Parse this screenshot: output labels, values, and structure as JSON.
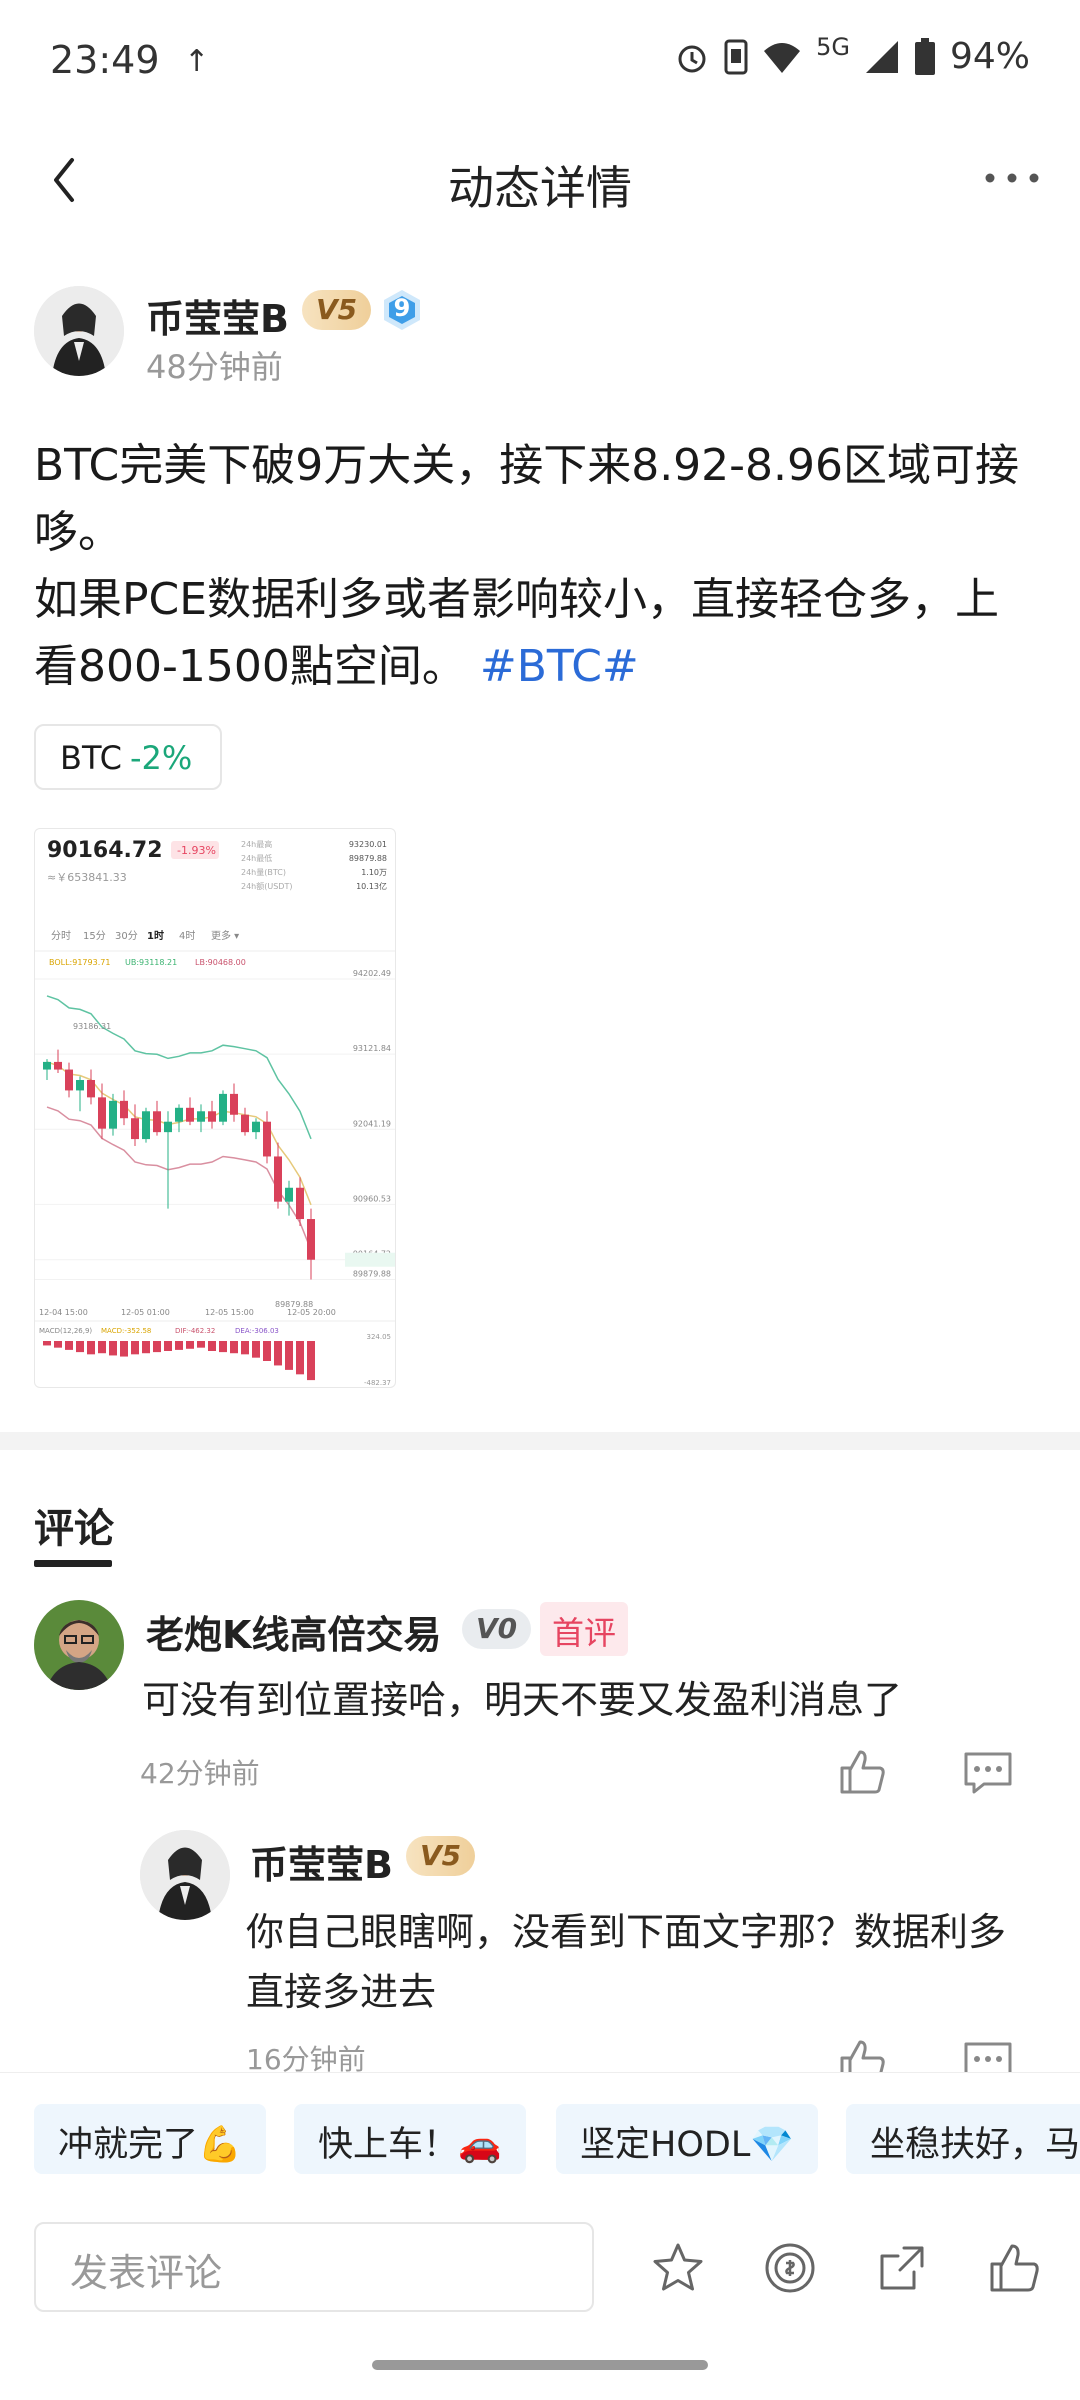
{
  "status_bar": {
    "time": "23:49",
    "network": "5G",
    "battery": "94%"
  },
  "nav": {
    "title": "动态详情"
  },
  "post": {
    "author": "币莹莹B",
    "level_badge": "V5",
    "rank_badge": "9",
    "time": "48分钟前",
    "text_line1": "BTC完美下破9万大关，接下来8.92-8.96区域可接",
    "text_line2": "哆。",
    "text_line3": "如果PCE数据利多或者影响较小，直接轻仓多，上",
    "text_line4": "看800-1500點空间。",
    "hashtag": "#BTC#",
    "tag": {
      "symbol": "BTC",
      "change": "-2%"
    }
  },
  "chart_data": {
    "type": "candlestick",
    "price": "90164.72",
    "change_pct": "-1.93%",
    "cny_price": "≈￥653841.33",
    "stats": [
      "24h最高",
      "24h最低",
      "24h量(BTC)",
      "24h额(USDT)"
    ],
    "stat_values": [
      "93230.01",
      "89879.88",
      "1.10万",
      "10.13亿"
    ],
    "intervals": [
      "分时",
      "15分",
      "30分",
      "1时",
      "4时",
      "更多"
    ],
    "selected_interval": "1时",
    "boll_label": "BOLL:91793.71",
    "ub_label": "UB:93118.21",
    "lb_label": "LB:90468.00",
    "price_ticks": [
      "94202.49",
      "93121.84",
      "92041.19",
      "90960.53",
      "90164.72",
      "89879.88"
    ],
    "time_ticks": [
      "12-04 15:00",
      "12-05 01:00",
      "12-05 15:00",
      "12-05 20:00"
    ],
    "high_mark": "93186.31",
    "low_mark": "89879.88",
    "macd_label": "MACD(12,26,9)",
    "macd_value": "MACD:-352.58",
    "dif_value": "DIF:-462.32",
    "dea_value": "DEA:-306.03",
    "macd_ticks": [
      "324.05",
      "-482.37"
    ],
    "candles": [
      [
        92900,
        93050,
        92750,
        93010
      ],
      [
        93010,
        93186,
        92850,
        92900
      ],
      [
        92900,
        93000,
        92500,
        92600
      ],
      [
        92600,
        92800,
        92300,
        92750
      ],
      [
        92750,
        92900,
        92400,
        92500
      ],
      [
        92500,
        92700,
        91900,
        92050
      ],
      [
        92050,
        92550,
        91950,
        92450
      ],
      [
        92450,
        92600,
        92100,
        92200
      ],
      [
        92200,
        92400,
        91800,
        91900
      ],
      [
        91900,
        92350,
        91850,
        92300
      ],
      [
        92300,
        92450,
        91950,
        92000
      ],
      [
        92000,
        92300,
        90900,
        92150
      ],
      [
        92150,
        92400,
        92000,
        92350
      ],
      [
        92350,
        92500,
        92100,
        92150
      ],
      [
        92150,
        92400,
        92000,
        92300
      ],
      [
        92300,
        92450,
        92050,
        92150
      ],
      [
        92150,
        92600,
        92100,
        92550
      ],
      [
        92550,
        92700,
        92150,
        92250
      ],
      [
        92250,
        92350,
        91950,
        92000
      ],
      [
        92000,
        92200,
        91900,
        92150
      ],
      [
        92150,
        92300,
        91550,
        91650
      ],
      [
        91650,
        91850,
        90900,
        91000
      ],
      [
        91000,
        91300,
        90800,
        91200
      ],
      [
        91200,
        91350,
        90650,
        90750
      ],
      [
        90750,
        90900,
        89879.88,
        90164.72
      ]
    ],
    "macd_bars": [
      -40,
      -60,
      -80,
      -100,
      -120,
      -110,
      -130,
      -140,
      -120,
      -110,
      -100,
      -90,
      -80,
      -70,
      -60,
      -90,
      -100,
      -110,
      -120,
      -150,
      -180,
      -220,
      -260,
      -300,
      -352
    ]
  },
  "comments_tab": {
    "title": "评论"
  },
  "comment1": {
    "author": "老炮K线高倍交易",
    "level_badge": "V0",
    "first_tag": "首评",
    "text": "可没有到位置接哈，明天不要又发盈利消息了",
    "time": "42分钟前"
  },
  "reply1": {
    "author": "币莹莹B",
    "level_badge": "V5",
    "text_line1": "你自己眼瞎啊，没看到下面文字那？数据利多",
    "text_line2": "直接多进去",
    "time": "16分钟前"
  },
  "quick_replies": [
    "冲就完了💪",
    "快上车！🚗",
    "坚定HODL💎",
    "坐稳扶好，马"
  ],
  "comment_input": {
    "placeholder": "发表评论"
  }
}
